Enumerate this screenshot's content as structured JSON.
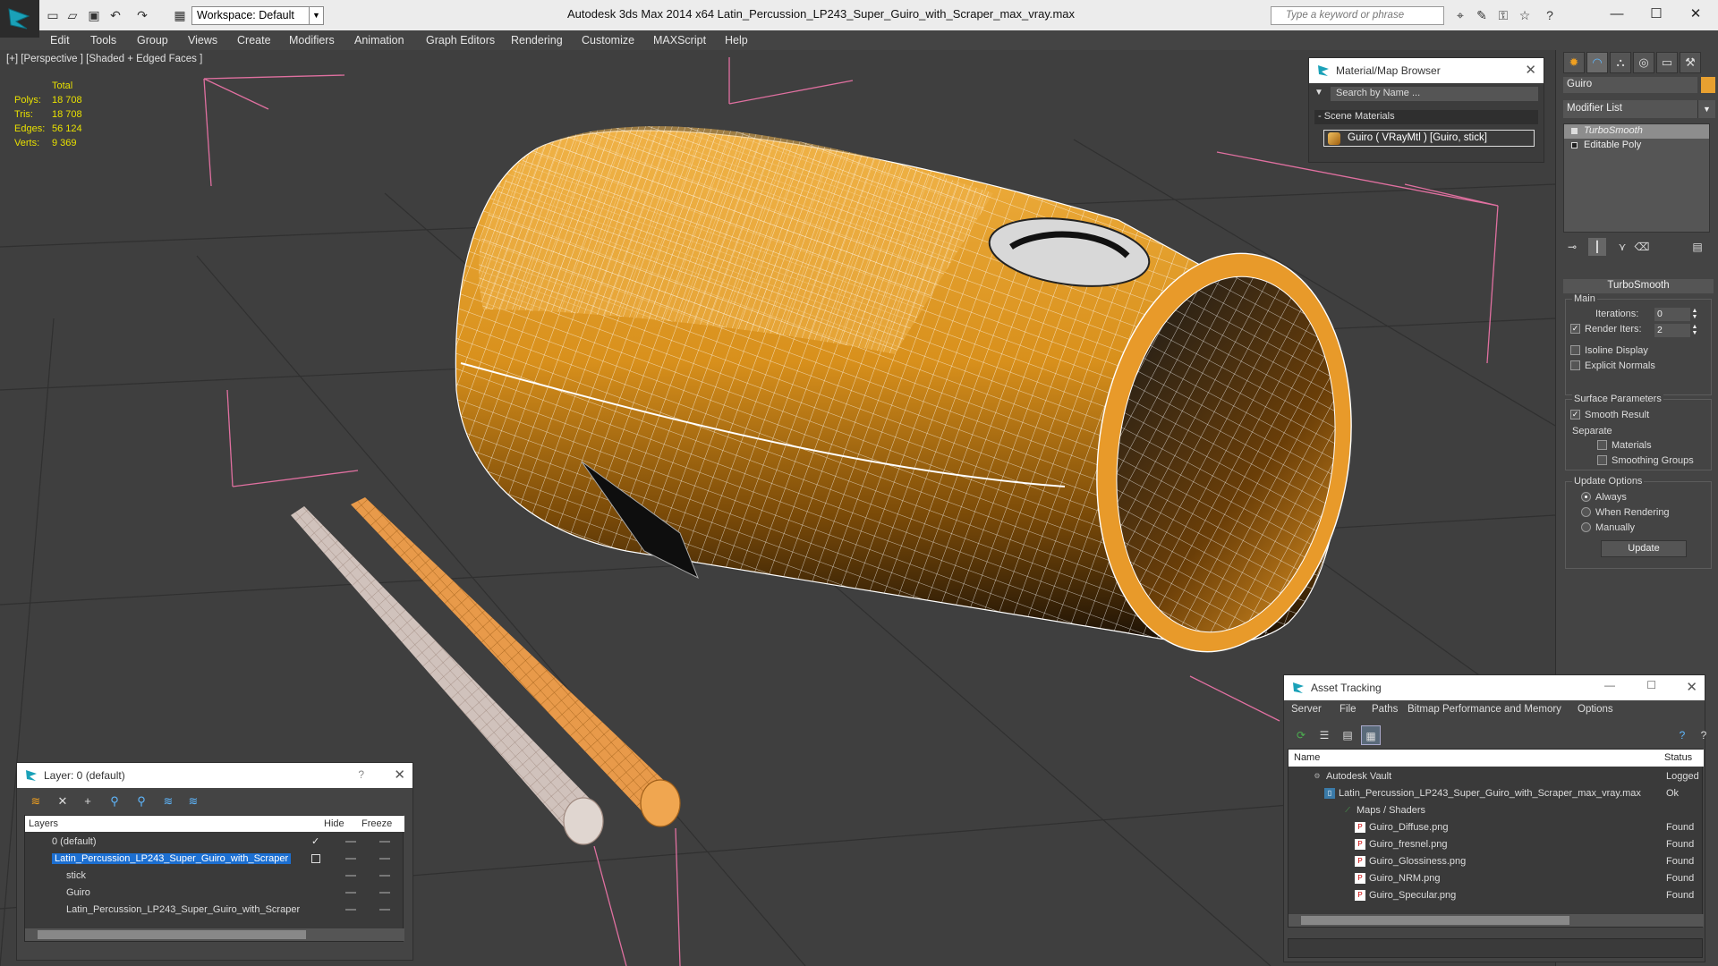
{
  "app": {
    "title": "Autodesk 3ds Max  2014 x64      Latin_Percussion_LP243_Super_Guiro_with_Scraper_max_vray.max",
    "workspace": "Workspace: Default",
    "search_placeholder": "Type a keyword or phrase",
    "minimize": "—",
    "maximize": "☐",
    "close": "✕"
  },
  "menu": [
    "Edit",
    "Tools",
    "Group",
    "Views",
    "Create",
    "Modifiers",
    "Animation",
    "Graph Editors",
    "Rendering",
    "Customize",
    "MAXScript",
    "Help"
  ],
  "viewport": {
    "label": "[+] [Perspective ] [Shaded + Edged Faces ]",
    "stats": {
      "header": "Total",
      "rows": [
        {
          "k": "Polys:",
          "v": "18 708"
        },
        {
          "k": "Tris:",
          "v": "18 708"
        },
        {
          "k": "Edges:",
          "v": "56 124"
        },
        {
          "k": "Verts:",
          "v": "9 369"
        }
      ]
    }
  },
  "material_browser": {
    "title": "Material/Map Browser",
    "search": "Search by Name ...",
    "section": "- Scene Materials",
    "item": "Guiro  ( VRayMtl ) [Guiro, stick]"
  },
  "command_panel": {
    "object_name": "Guiro",
    "modifier_list": "Modifier List",
    "stack": [
      "TurboSmooth",
      "Editable Poly"
    ],
    "rollout_title": "TurboSmooth",
    "main_label": "Main",
    "iterations_label": "Iterations:",
    "iterations_value": "0",
    "render_iters_label": "Render Iters:",
    "render_iters_value": "2",
    "isoline_label": "Isoline Display",
    "explicit_normals_label": "Explicit Normals",
    "surface_params_label": "Surface Parameters",
    "smooth_result_label": "Smooth Result",
    "separate_label": "Separate",
    "materials_label": "Materials",
    "smoothing_groups_label": "Smoothing Groups",
    "update_options_label": "Update Options",
    "always_label": "Always",
    "when_rendering_label": "When Rendering",
    "manually_label": "Manually",
    "update_button": "Update"
  },
  "layer_panel": {
    "title": "Layer: 0 (default)",
    "help": "?",
    "close": "✕",
    "col_layers": "Layers",
    "col_hide": "Hide",
    "col_freeze": "Freeze",
    "rows": [
      {
        "name": "0 (default)"
      },
      {
        "name": "Latin_Percussion_LP243_Super_Guiro_with_Scraper"
      },
      {
        "name": "stick"
      },
      {
        "name": "Guiro"
      },
      {
        "name": "Latin_Percussion_LP243_Super_Guiro_with_Scraper"
      }
    ]
  },
  "asset_tracking": {
    "title": "Asset Tracking",
    "menu": [
      "Server",
      "File",
      "Paths",
      "Bitmap Performance and Memory",
      "Options"
    ],
    "col_name": "Name",
    "col_status": "Status",
    "rows": [
      {
        "name": "Autodesk Vault",
        "status": "Logged"
      },
      {
        "name": "Latin_Percussion_LP243_Super_Guiro_with_Scraper_max_vray.max",
        "status": "Ok"
      },
      {
        "name": "Maps / Shaders",
        "status": ""
      },
      {
        "name": "Guiro_Diffuse.png",
        "status": "Found"
      },
      {
        "name": "Guiro_fresnel.png",
        "status": "Found"
      },
      {
        "name": "Guiro_Glossiness.png",
        "status": "Found"
      },
      {
        "name": "Guiro_NRM.png",
        "status": "Found"
      },
      {
        "name": "Guiro_Specular.png",
        "status": "Found"
      }
    ]
  },
  "colors": {
    "guiro_orange": "#e89a2a",
    "selection_blue": "#1c6fd1",
    "stats_yellow": "#e8e000"
  }
}
